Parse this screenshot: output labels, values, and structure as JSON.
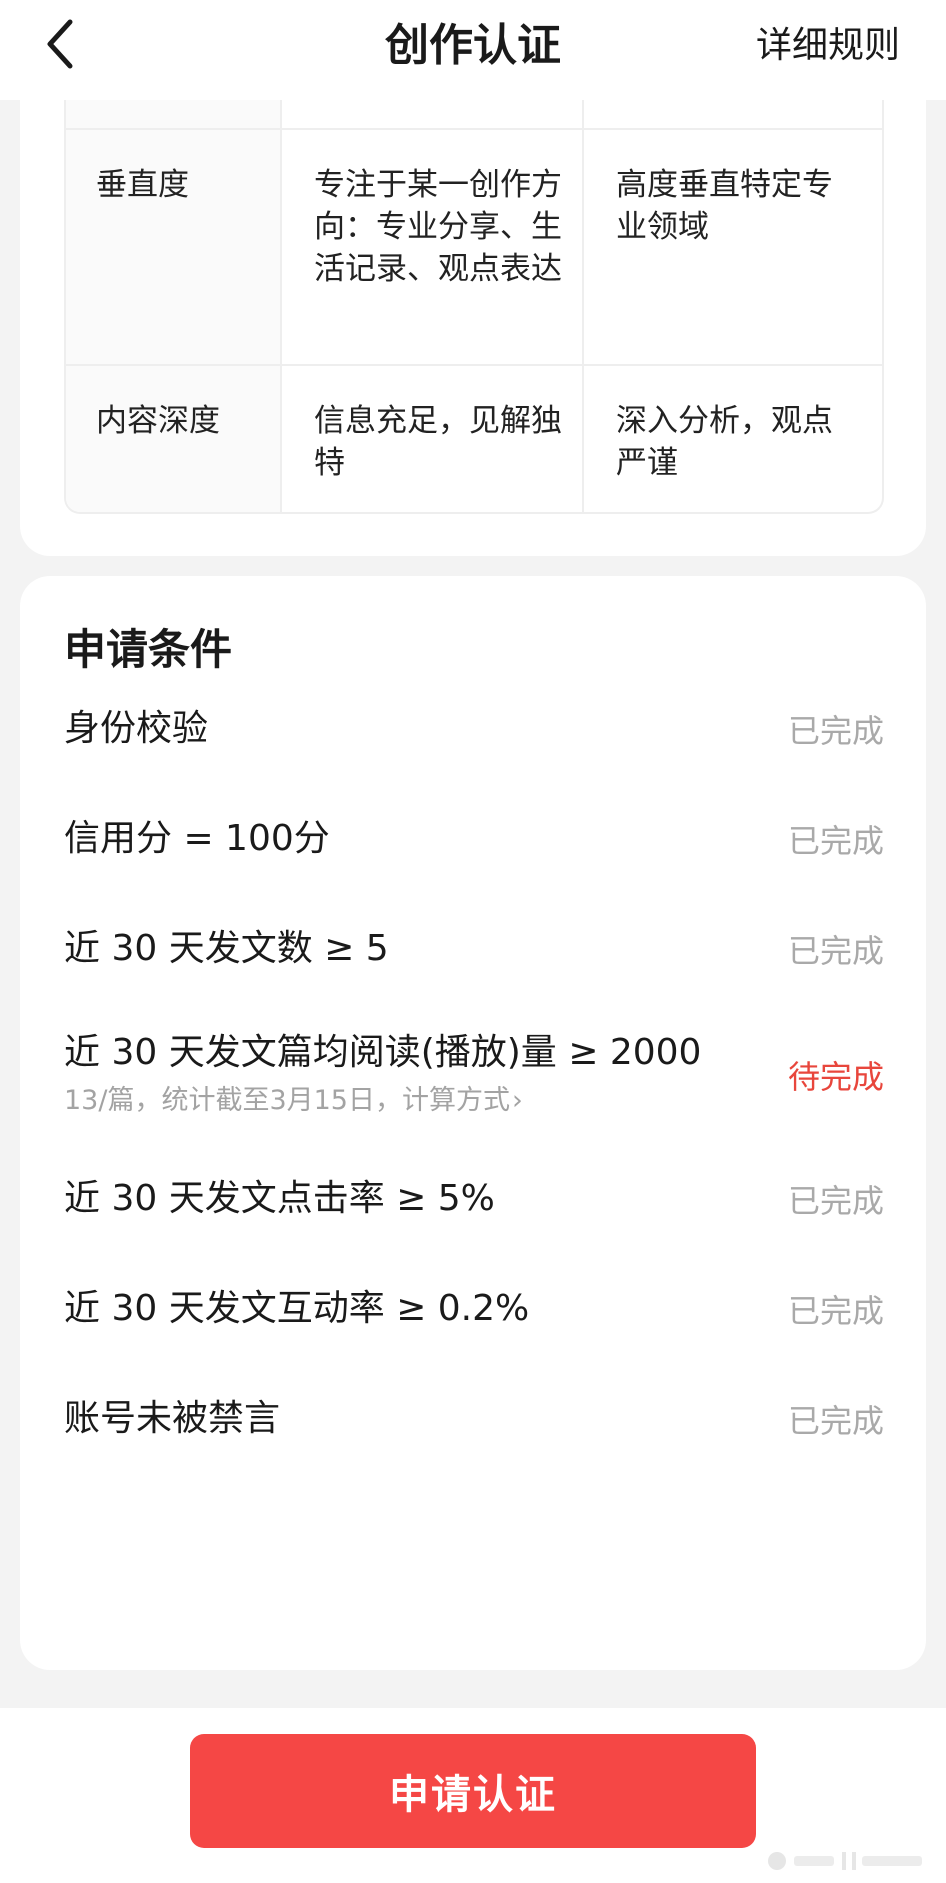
{
  "header": {
    "title": "创作认证",
    "rules_link": "详细规则"
  },
  "criteria_table": {
    "rows": [
      {
        "name": "垂直度",
        "standard": "专注于某一创作方向：专业分享、生活记录、观点表达",
        "advanced": "高度垂直特定专业领域"
      },
      {
        "name": "内容深度",
        "standard": "信息充足，见解独特",
        "advanced": "深入分析，观点严谨"
      }
    ]
  },
  "conditions": {
    "title": "申请条件",
    "items": [
      {
        "label": "身份校验",
        "status": "已完成"
      },
      {
        "label": "信用分 = 100分",
        "status": "已完成"
      },
      {
        "label": "近 30 天发文数 ≥ 5",
        "status": "已完成"
      },
      {
        "label": "近 30 天发文篇均阅读(播放)量 ≥ 2000",
        "status": "待完成",
        "sub": "13/篇，统计截至3月15日，计算方式",
        "sub_chevron": "›"
      },
      {
        "label": "近 30 天发文点击率 ≥ 5%",
        "status": "已完成"
      },
      {
        "label": "近 30 天发文互动率 ≥ 0.2%",
        "status": "已完成"
      },
      {
        "label": "账号未被禁言",
        "status": "已完成"
      }
    ]
  },
  "footer": {
    "apply_button": "申请认证"
  },
  "colors": {
    "accent": "#f54745",
    "pending": "#e8463c",
    "done": "#a9a9a9"
  },
  "icons": {
    "back": "back-chevron-icon",
    "sub_link": "chevron-right-icon"
  }
}
